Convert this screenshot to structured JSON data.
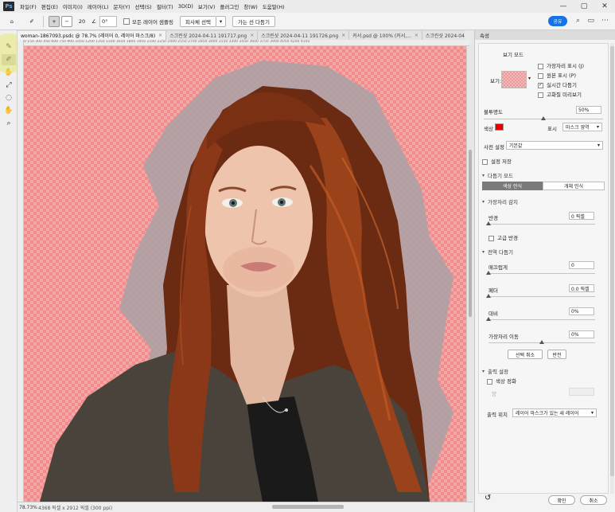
{
  "menu": {
    "logo": "Ps",
    "items": [
      "파일(F)",
      "편집(E)",
      "이미지(I)",
      "레이어(L)",
      "문자(Y)",
      "선택(S)",
      "필터(T)",
      "3D(D)",
      "보기(V)",
      "플러그인",
      "창(W)",
      "도움말(H)"
    ],
    "win_min": "—",
    "win_max": "▢",
    "win_close": "✕"
  },
  "options": {
    "angle": "0°",
    "brush_size": "20",
    "sample_all_label": "모든 레이어 샘플링",
    "subject_btn": "피사체 선택",
    "refine_hair_btn": "가는 선 다듬기",
    "share_btn": "공유",
    "search_icon": "⌕",
    "panel_icon": "▭",
    "more_icon": "⋯"
  },
  "tools": [
    "✎",
    "✐",
    "✋",
    "⤢",
    "◌",
    "✋",
    "⌕"
  ],
  "tabs": [
    {
      "label": "woman-1867093.psdc @ 78.7% (레이어 0, 레이어 마스크/8)",
      "active": true
    },
    {
      "label": "스크린샷 2024-04-11 191717.png",
      "active": false
    },
    {
      "label": "스크린샷 2024-04-11 191726.png",
      "active": false
    },
    {
      "label": "커서.psd @ 100% (커서,...",
      "active": false
    },
    {
      "label": "스크린샷 2024-04",
      "active": false
    }
  ],
  "ruler_ticks": "0    150   300   450   600   750   900   1050  1200  1350  1500  1650  1800  1950  2100  2250  2400  2550  2700  2850  3000  3150  3300  3450  3600  3750  3900  4050  4200  4350",
  "status": {
    "zoom": "78.73%",
    "info": "4368 픽셀 x 2912 픽셀 (300 ppi)"
  },
  "panel": {
    "tab": "속성",
    "view_mode": {
      "title": "보기 모드",
      "view_label": "보기:",
      "show_edge": "가장자리 표시 (J)",
      "show_original": "원본 표시 (P)",
      "realtime_refine": "실시간 다듬기",
      "hq_preview": "고화질 미리보기",
      "realtime_checked": true
    },
    "opacity_label": "불투명도",
    "opacity_value": "50%",
    "opacity_fraction": 0.5,
    "color_label": "색상",
    "color_hex": "#e50000",
    "show_label": "표시",
    "show_value": "마스크 영역",
    "preset_label": "사전 설정",
    "preset_value": "기본값",
    "remember_label": "설정 저장",
    "refine_mode": {
      "title": "다듬기 모드",
      "color_aware": "색상 인식",
      "object_aware": "개체 인식"
    },
    "edge_detect": {
      "title": "가장자리 감지",
      "radius_label": "반경",
      "radius_value": "0 픽셀",
      "radius_fraction": 0,
      "smart_radius": "고급 반경"
    },
    "global_refine": {
      "title": "전역 다듬기",
      "smooth_label": "매끄럽게",
      "smooth_value": "0",
      "smooth_fraction": 0,
      "feather_label": "페더",
      "feather_value": "0.0 픽셀",
      "feather_fraction": 0,
      "contrast_label": "대비",
      "contrast_value": "0%",
      "contrast_fraction": 0,
      "shift_label": "가장자리 이동",
      "shift_value": "0%",
      "shift_fraction": 0.5,
      "clear_btn": "선택 취소",
      "invert_btn": "반전"
    },
    "output": {
      "title": "출력 설정",
      "decontaminate": "색상 정화",
      "amount_label": "양",
      "output_to_label": "출력 위치",
      "output_to_value": "레이어 마스크가 있는 새 레이어"
    },
    "ok_btn": "확인",
    "cancel_btn": "취소",
    "reset_icon": "↺"
  }
}
